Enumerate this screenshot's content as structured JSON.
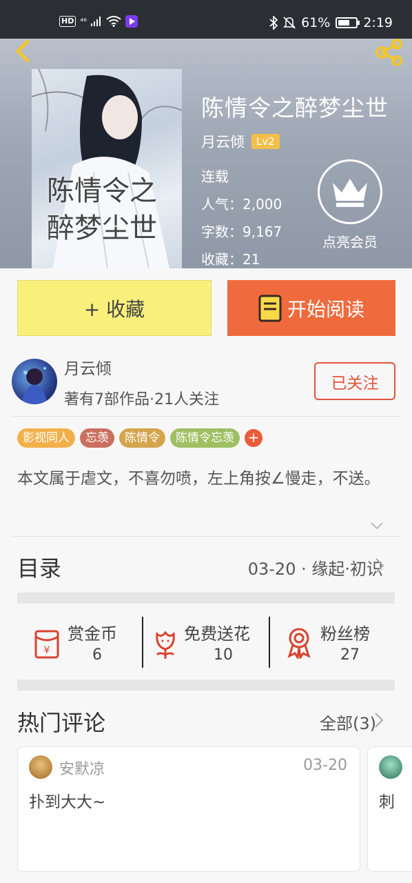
{
  "status_bar": {
    "left_indicators": [
      "HD",
      "4G",
      "signal-icon",
      "wifi-icon",
      "app-icon"
    ],
    "hd": "HD",
    "network": "⁴⁶",
    "battery_pct": "61%",
    "time": "2:19"
  },
  "book": {
    "title": "陈情令之醉梦尘世",
    "cover_title": "陈情令之醉梦尘世",
    "author": "月云倾",
    "level": "Lv2",
    "status": "连载",
    "popularity": "人气：2,000",
    "word_count": "字数：9,167",
    "favorites": "收藏：21",
    "member_label": "点亮会员"
  },
  "actions": {
    "collect_label": "+ 收藏",
    "read_label": "开始阅读"
  },
  "author_block": {
    "name": "月云倾",
    "stats": "著有7部作品·21人关注",
    "follow_label": "已关注"
  },
  "tags": [
    {
      "label": "影视同人",
      "color": "#f3b04a"
    },
    {
      "label": "忘羡",
      "color": "#c9705e"
    },
    {
      "label": "陈情令",
      "color": "#d4a54d"
    },
    {
      "label": "陈情令忘羡",
      "color": "#9fbf63"
    }
  ],
  "tag_add": "+",
  "description": "本文属于虐文，不喜勿喷，左上角按∠慢走，不送。",
  "catalog": {
    "label": "目录",
    "latest": "03-20 · 缘起·初识"
  },
  "stats": [
    {
      "label": "赏金币",
      "value": "6",
      "icon": "red-packet-icon"
    },
    {
      "label": "免费送花",
      "value": "10",
      "icon": "flower-icon"
    },
    {
      "label": "粉丝榜",
      "value": "27",
      "icon": "medal-icon"
    }
  ],
  "comments": {
    "title": "热门评论",
    "all_label": "全部(3)",
    "items": [
      {
        "user": "安默凉",
        "date": "03-20",
        "text": "扑到大大~"
      },
      {
        "user": "",
        "date": "",
        "text": "刺"
      }
    ]
  },
  "colors": {
    "accent_orange": "#ef6a3c",
    "collect_yellow": "#f9f07c",
    "follow_red": "#e0533a",
    "level_gold": "#f2c04a",
    "icon_red": "#d9432f"
  }
}
